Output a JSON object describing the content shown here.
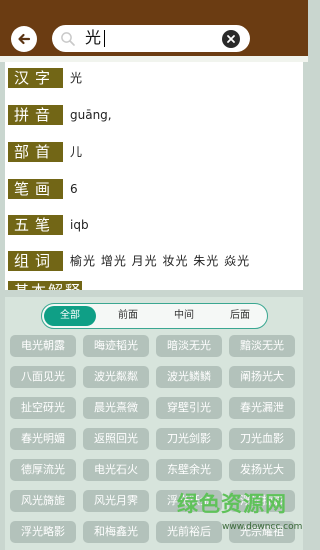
{
  "search": {
    "value": "光"
  },
  "info": [
    {
      "label": "汉字",
      "value": "光"
    },
    {
      "label": "拼音",
      "value": "guāng,"
    },
    {
      "label": "部首",
      "value": "儿"
    },
    {
      "label": "笔画",
      "value": "6"
    },
    {
      "label": "五笔",
      "value": "iqb"
    },
    {
      "label": "组词",
      "value": "榆光 增光 月光 妆光 朱光 焱光"
    },
    {
      "label": "基本解释",
      "value": ""
    }
  ],
  "tabs": [
    "全部",
    "前面",
    "中间",
    "后面"
  ],
  "active_tab": "全部",
  "words": [
    "电光朝露",
    "晦迹韬光",
    "暗淡无光",
    "黯淡无光",
    "八面见光",
    "波光粼粼",
    "波光鳞鳞",
    "阐扬光大",
    "扯空砑光",
    "晨光熹微",
    "穿壁引光",
    "春光漏泄",
    "春光明媚",
    "返照回光",
    "刀光剑影",
    "刀光血影",
    "德厚流光",
    "电光石火",
    "东壁余光",
    "发扬光大",
    "风光旖旎",
    "风光月霁",
    "浮光跃金",
    "浮光掠影",
    "浮光略影",
    "和梅鑫光",
    "光前裕后",
    "光宗耀祖"
  ],
  "watermark": {
    "text": "绿色资源网",
    "url": "www.downcc.com"
  },
  "colors": {
    "header": "#6b3c12",
    "label_bg": "#726616",
    "tab_active": "#0f9f86",
    "word_bg": "#b3c2bb"
  }
}
